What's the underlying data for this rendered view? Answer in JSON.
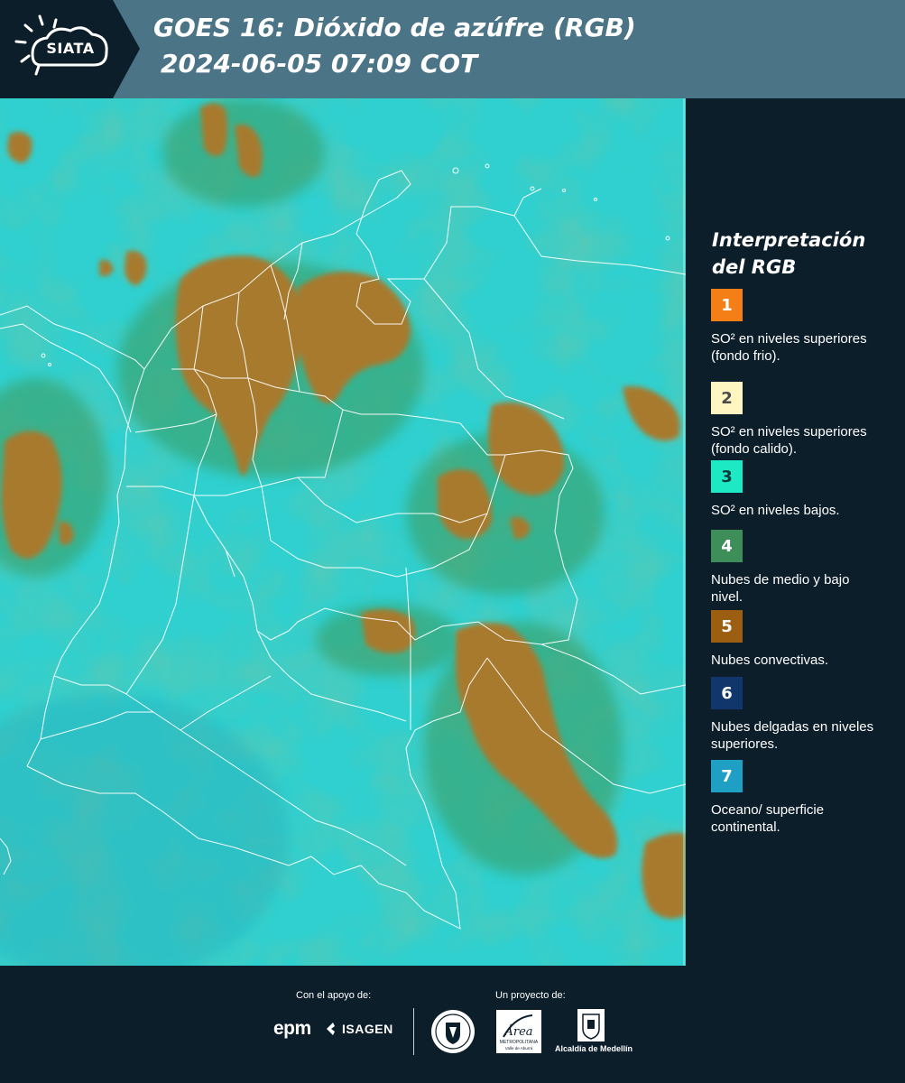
{
  "header": {
    "logo_text": "SIATA",
    "title_line1": "GOES 16: Dióxido de azúfre (RGB)",
    "title_line2": "2024-06-05 07:09 COT"
  },
  "legend": {
    "title_line1": "Interpretación",
    "title_line2": "del RGB",
    "items": [
      {
        "number": "1",
        "label": "SO² en niveles superiores (fondo frio).",
        "color": "#f57f17",
        "text_color": "#ffffff"
      },
      {
        "number": "2",
        "label": "SO² en niveles superiores (fondo calido).",
        "color": "#fff6c2",
        "text_color": "#4a4a4a"
      },
      {
        "number": "3",
        "label": "SO² en niveles bajos.",
        "color": "#1de9c4",
        "text_color": "#0d3b3a"
      },
      {
        "number": "4",
        "label": "Nubes de medio y bajo nivel.",
        "color": "#3e8e5a",
        "text_color": "#ffffff"
      },
      {
        "number": "5",
        "label": "Nubes convectivas.",
        "color": "#9c5e10",
        "text_color": "#ffffff"
      },
      {
        "number": "6",
        "label": "Nubes delgadas en niveles superiores.",
        "color": "#10366b",
        "text_color": "#ffffff"
      },
      {
        "number": "7",
        "label": "Oceano/ superficie continental.",
        "color": "#1e9fc3",
        "text_color": "#ffffff"
      }
    ]
  },
  "footer": {
    "support_label": "Con el apoyo de:",
    "project_label": "Un proyecto de:",
    "sponsor_epm": "epm",
    "sponsor_isagen": "ISAGEN",
    "partner_area": "Área",
    "partner_area_sub1": "METROPOLITANA",
    "partner_area_sub2": "Valle de Aburrá",
    "partner_alcaldia": "Alcaldía de Medellín",
    "partner_seal": "MEDELLÍN"
  },
  "map_colors": {
    "background": "#2fd0cf",
    "convective": "#a77a2f",
    "green": "#3f9a5f",
    "boundary": "#ffffff"
  }
}
